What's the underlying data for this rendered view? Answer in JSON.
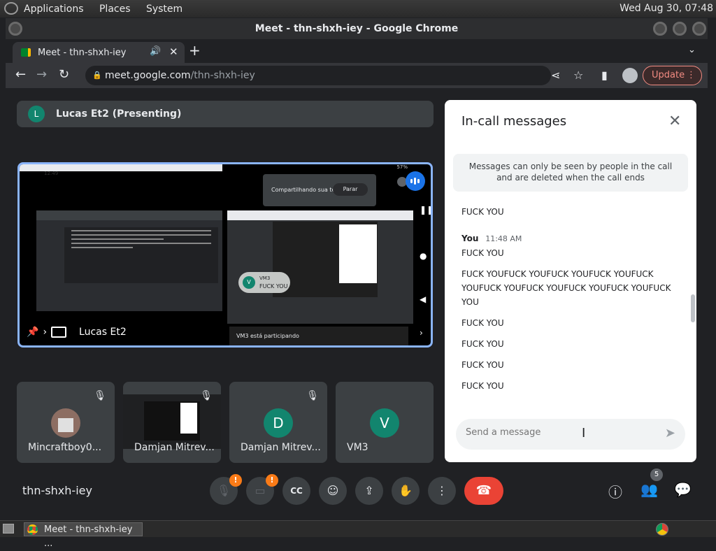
{
  "system_bar": {
    "menus": [
      "Applications",
      "Places",
      "System"
    ],
    "clock": "Wed Aug 30, 07:48"
  },
  "window": {
    "title": "Meet - thn-shxh-iey - Google Chrome"
  },
  "browser": {
    "tab_title": "Meet - thn-shxh-iey",
    "url_host": "meet.google.com",
    "url_path": "/thn-shxh-iey",
    "update_label": "Update"
  },
  "meet": {
    "presenter_initial": "L",
    "presenter_bar": "Lucas Et2 (Presenting)",
    "main_tile_name": "Lucas Et2",
    "screen_share": {
      "phone_time": "12:49",
      "phone_battery": "57%",
      "sharing_text": "Compartilhando sua tela",
      "stop_label": "Parar",
      "bubble_initial": "V",
      "bubble_name": "VM3",
      "bubble_message": "FUCK YOU",
      "join_text": "VM3 está participando"
    },
    "tiles": [
      {
        "name": "Mincraftboy0...",
        "muted": true
      },
      {
        "name": "Damjan Mitrev...",
        "muted": true
      },
      {
        "name": "Damjan Mitrev...",
        "initial": "D",
        "color": "#12856e",
        "muted": true
      },
      {
        "name": "VM3",
        "initial": "V",
        "color": "#12856e",
        "muted": false
      }
    ],
    "meeting_code": "thn-shxh-iey",
    "people_count": "5"
  },
  "chat": {
    "title": "In-call messages",
    "notice": "Messages can only be seen by people in the call and are deleted when the call ends",
    "messages_top": "FUCK YOU",
    "sender": "You",
    "time": "11:48 AM",
    "messages": [
      "FUCK YOU",
      "FUCK YOUFUCK YOUFUCK YOUFUCK YOUFUCK YOUFUCK YOUFUCK YOUFUCK YOUFUCK YOUFUCK YOU",
      "FUCK YOU",
      "FUCK YOU",
      "FUCK YOU",
      "FUCK YOU"
    ],
    "placeholder": "Send a message"
  },
  "taskbar": {
    "window_button": "Meet - thn-shxh-iey ..."
  }
}
